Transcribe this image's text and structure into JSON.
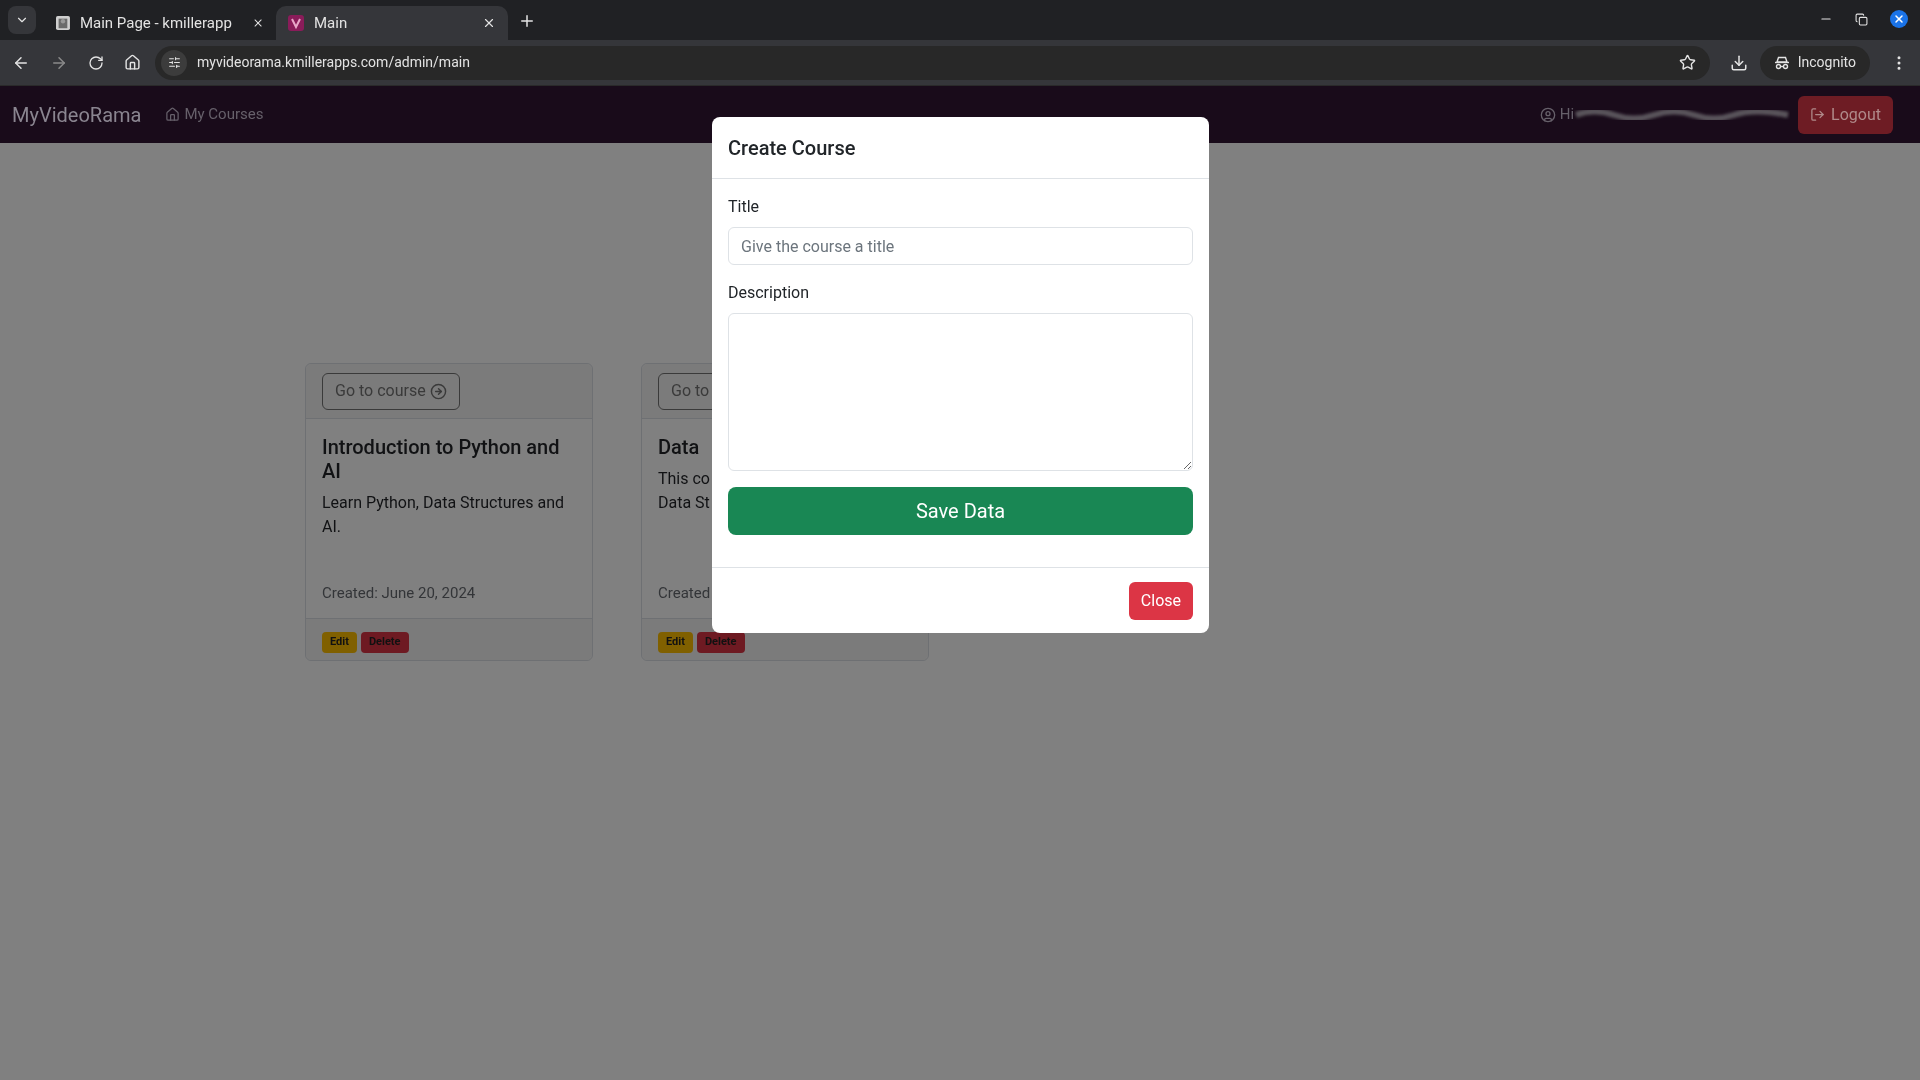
{
  "browser": {
    "tabs": [
      {
        "title": "Main Page - kmillerapp",
        "selected": false,
        "kind": "photo"
      },
      {
        "title": "Main",
        "selected": true,
        "kind": "logo"
      }
    ],
    "address": "myvideorama.kmillerapps.com/admin/main",
    "profile": "Incognito"
  },
  "navbar": {
    "brand": "MyVideoRama",
    "links": [
      {
        "label": "My Courses"
      }
    ],
    "greeting": "Hi",
    "logout": "Logout"
  },
  "courses": [
    {
      "go_label": "Go to course",
      "title": "Introduction to Python and AI",
      "description_lines": [
        "Learn Python, Data Structures and AI."
      ],
      "created": "Created: June 20, 2024",
      "edit": "Edit",
      "delete": "Delete"
    },
    {
      "go_label": "Go to",
      "title": "Data",
      "description_lines": [
        "This co",
        "Data St"
      ],
      "created": "Created",
      "edit": "Edit",
      "delete": "Delete"
    }
  ],
  "modal": {
    "title": "Create Course",
    "fields": [
      {
        "kind": "input",
        "label": "Title",
        "placeholder": "Give the course a title"
      },
      {
        "kind": "textarea",
        "label": "Description"
      }
    ],
    "submit": "Save Data",
    "close": "Close"
  }
}
